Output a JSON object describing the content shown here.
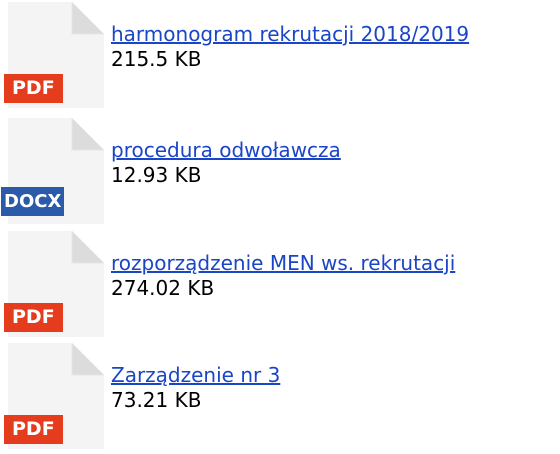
{
  "files": [
    {
      "type_label": "PDF",
      "icon": "pdf-file-icon",
      "name": "harmonogram rekrutacji 2018/2019",
      "size": "215.5 KB"
    },
    {
      "type_label": "DOCX",
      "icon": "docx-file-icon",
      "name": "procedura odwoławcza",
      "size": "12.93 KB"
    },
    {
      "type_label": "PDF",
      "icon": "pdf-file-icon",
      "name": "rozporządzenie MEN ws. rekrutacji",
      "size": "274.02 KB"
    },
    {
      "type_label": "PDF",
      "icon": "pdf-file-icon",
      "name": "Zarządzenie nr 3",
      "size": "73.21 KB"
    }
  ],
  "colors": {
    "link": "#1b45c7",
    "pdf_badge": "#e63c1e",
    "docx_badge": "#2a5aa8",
    "page_body": "#f4f4f4",
    "page_fold": "#dcdcdc"
  }
}
